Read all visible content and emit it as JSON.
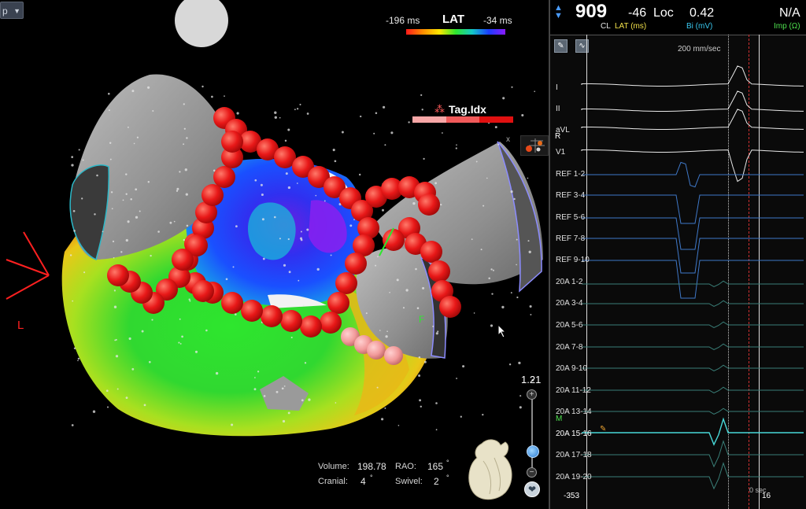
{
  "map_view": {
    "dropdown_value": "p",
    "lat_legend": {
      "min_label": "-196 ms",
      "title": "LAT",
      "max_label": "-34 ms"
    },
    "tag_legend": {
      "title": "Tag.Idx",
      "colors": [
        "#f7a6a6",
        "#f05a5a",
        "#e01010"
      ]
    },
    "tag_close": "x",
    "orientation_label": "L",
    "zoom_value": "1.21",
    "zoom_plus": "+",
    "zoom_minus": "−",
    "stats": {
      "volume_label": "Volume:",
      "volume_value": "198.78",
      "rao_label": "RAO:",
      "rao_value": "165",
      "cranial_label": "Cranial:",
      "cranial_value": "4",
      "swivel_label": "Swivel:",
      "swivel_value": "2",
      "degree_symbol": "°"
    },
    "colors": {
      "tag_point": "#e81818",
      "tag_point_light": "#f29a9a",
      "lat_early": "#ff1a1a",
      "lat_late": "#8a1aff"
    }
  },
  "signal_panel": {
    "header": {
      "cycle_length": "909",
      "cycle_length_label": "CL",
      "lat_value": "-46",
      "loc_label": "Loc",
      "lat_label": "LAT (ms)",
      "bi_value": "0.42",
      "bi_label": "Bi (mV)",
      "imp_value": "N/A",
      "imp_label": "Imp (Ω)"
    },
    "sweep_speed": "200 mm/sec",
    "channels": [
      "I",
      "II",
      "aVL",
      "V1",
      "REF 1-2",
      "REF 3-4",
      "REF 5-6",
      "REF 7-8",
      "REF 9-10",
      "20A 1-2",
      "20A 3-4",
      "20A 5-6",
      "20A 7-8",
      "20A 9-10",
      "20A 11-12",
      "20A 13-14",
      "20A 15-16",
      "20A 17-18",
      "20A 19-20"
    ],
    "markers": {
      "r": "R",
      "m": "M"
    },
    "footer": {
      "left_value": "-353",
      "time_label": "0 sec",
      "right_value": "16"
    }
  }
}
